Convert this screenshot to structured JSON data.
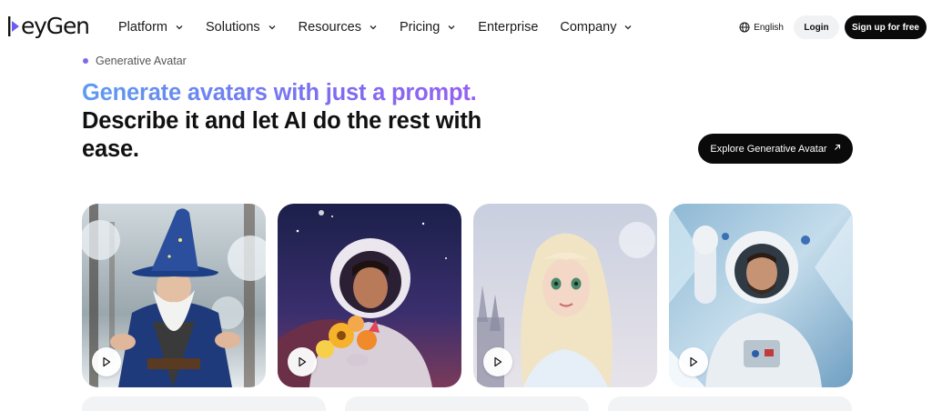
{
  "brand": {
    "name": "HeyGen",
    "logo_text": "eyGen"
  },
  "nav": {
    "items": [
      {
        "label": "Platform",
        "dropdown": true
      },
      {
        "label": "Solutions",
        "dropdown": true
      },
      {
        "label": "Resources",
        "dropdown": true
      },
      {
        "label": "Pricing",
        "dropdown": true
      },
      {
        "label": "Enterprise",
        "dropdown": false
      },
      {
        "label": "Company",
        "dropdown": true
      }
    ],
    "language": "English",
    "login_label": "Login",
    "signup_label": "Sign up for free"
  },
  "hero": {
    "eyebrow": "Generative Avatar",
    "headline_gradient": "Generate avatars with just a prompt.",
    "headline_rest": "Describe it and let AI do the rest with ease.",
    "cta_label": "Explore Generative Avatar",
    "accent_gradient": [
      "#5d9cf0",
      "#7e6cf0",
      "#9b5ef0"
    ]
  },
  "cards": [
    {
      "subject": "wizard avatar in snowy forest",
      "icon": "play-icon"
    },
    {
      "subject": "astronaut girl holding flowers",
      "icon": "play-icon"
    },
    {
      "subject": "animated princess in winter",
      "icon": "play-icon"
    },
    {
      "subject": "astronaut waving in ice",
      "icon": "play-icon"
    }
  ]
}
